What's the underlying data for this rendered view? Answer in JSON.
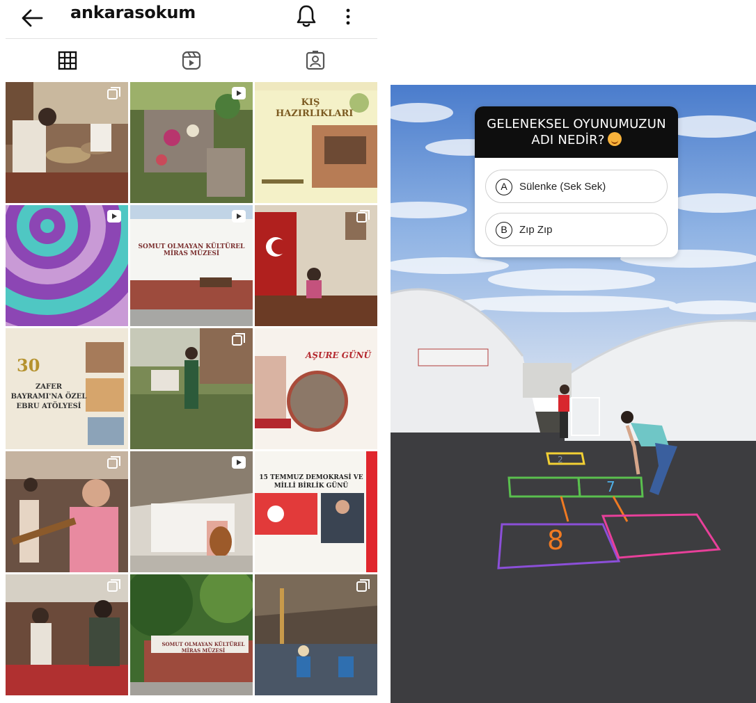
{
  "profile": {
    "username": "ankarasokum",
    "icons": {
      "back": "arrow-left-icon",
      "notifications": "bell-icon",
      "more": "more-vertical-icon"
    },
    "tabs": [
      {
        "name": "posts",
        "icon": "grid-icon"
      },
      {
        "name": "reels",
        "icon": "reels-icon"
      },
      {
        "name": "tagged",
        "icon": "tagged-person-icon"
      }
    ],
    "posts": [
      {
        "kind": "photo",
        "badge": "carousel-icon",
        "overlay": ""
      },
      {
        "kind": "photo",
        "badge": "reel-icon",
        "overlay": ""
      },
      {
        "kind": "poster",
        "badge": "",
        "overlay": "KIŞ HAZIRLIKLARI"
      },
      {
        "kind": "photo",
        "badge": "reel-icon",
        "overlay": ""
      },
      {
        "kind": "photo",
        "badge": "reel-icon",
        "overlay": "SOMUT OLMAYAN KÜLTÜREL MİRAS MÜZESİ"
      },
      {
        "kind": "photo",
        "badge": "carousel-icon",
        "overlay": ""
      },
      {
        "kind": "poster",
        "badge": "",
        "overlay": "ZAFER BAYRAMI'NA ÖZEL EBRU ATÖLYESİ"
      },
      {
        "kind": "photo",
        "badge": "carousel-icon",
        "overlay": ""
      },
      {
        "kind": "poster",
        "badge": "",
        "overlay": "AŞURE GÜNÜ"
      },
      {
        "kind": "photo",
        "badge": "carousel-icon",
        "overlay": ""
      },
      {
        "kind": "photo",
        "badge": "reel-icon",
        "overlay": ""
      },
      {
        "kind": "poster",
        "badge": "",
        "overlay": "15 TEMMUZ DEMOKRASİ VE MİLLİ BİRLİK GÜNÜ"
      },
      {
        "kind": "photo",
        "badge": "carousel-icon",
        "overlay": ""
      },
      {
        "kind": "photo",
        "badge": "",
        "overlay": "SOMUT OLMAYAN KÜLTÜREL MİRAS MÜZESİ"
      },
      {
        "kind": "photo",
        "badge": "carousel-icon",
        "overlay": ""
      }
    ]
  },
  "story": {
    "quiz": {
      "question": "GELENEKSEL OYUNUMUZUN ADI NEDİR?",
      "question_emoji": "smiling-face-with-hearts-icon",
      "options": [
        {
          "letter": "A",
          "text": "Sülenke (Sek Sek)"
        },
        {
          "letter": "B",
          "text": "Zıp Zıp"
        }
      ]
    },
    "hopscotch_numbers": [
      "8",
      "7",
      "2"
    ]
  },
  "colors": {
    "sky": "#5f8fd6",
    "tent": "#ecedef",
    "asphalt": "#3d3d40",
    "quiz_header": "#0e0e0e",
    "chalk_purple": "#8b4fd8",
    "chalk_pink": "#e8409a",
    "chalk_orange": "#f07a22",
    "chalk_green": "#5ac04e",
    "chalk_yellow": "#f2d034"
  }
}
